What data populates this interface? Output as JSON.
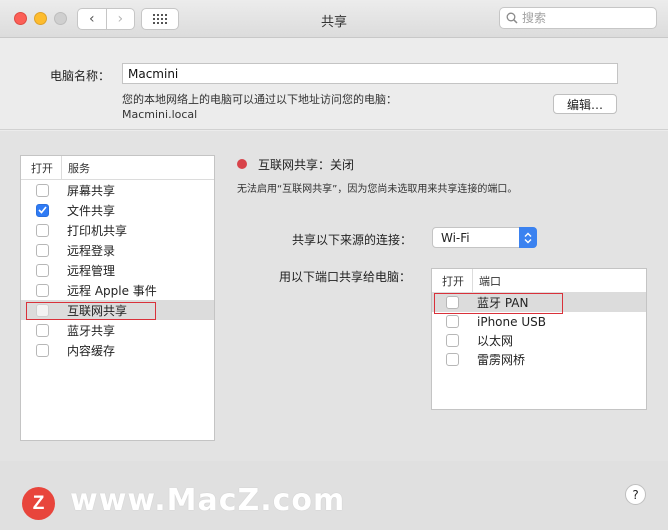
{
  "window": {
    "title": "共享"
  },
  "toolbar": {
    "back": "‹",
    "forward": "›",
    "search_placeholder": "搜索"
  },
  "computer_name": {
    "label": "电脑名称：",
    "value": "Macmini",
    "description_line1": "您的本地网络上的电脑可以通过以下地址访问您的电脑：",
    "description_line2": "Macmini.local",
    "edit_button": "编辑…"
  },
  "services": {
    "header_on": "打开",
    "header_service": "服务",
    "items": [
      {
        "label": "屏幕共享",
        "checked": false
      },
      {
        "label": "文件共享",
        "checked": true
      },
      {
        "label": "打印机共享",
        "checked": false
      },
      {
        "label": "远程登录",
        "checked": false
      },
      {
        "label": "远程管理",
        "checked": false
      },
      {
        "label": "远程 Apple 事件",
        "checked": false
      },
      {
        "label": "互联网共享",
        "checked": false,
        "selected": true
      },
      {
        "label": "蓝牙共享",
        "checked": false
      },
      {
        "label": "内容缓存",
        "checked": false
      }
    ]
  },
  "internet_sharing": {
    "status": "互联网共享：关闭",
    "status_color": "#d8434a",
    "description": "无法启用“互联网共享”，因为您尚未选取用来共享连接的端口。",
    "source_label": "共享以下来源的连接：",
    "source_value": "Wi-Fi",
    "ports_label": "用以下端口共享给电脑：",
    "ports_header_on": "打开",
    "ports_header_port": "端口",
    "ports": [
      {
        "label": "蓝牙 PAN",
        "checked": false,
        "selected": true
      },
      {
        "label": "iPhone USB",
        "checked": false
      },
      {
        "label": "以太网",
        "checked": false
      },
      {
        "label": "雷雳网桥",
        "checked": false
      }
    ]
  },
  "footer": {
    "watermark_letter": "Z",
    "watermark": "www.MacZ.com",
    "help": "?"
  },
  "colors": {
    "accent": "#2f7bf5",
    "highlight_box": "#d9313a",
    "watermark_red": "#e8453c"
  }
}
